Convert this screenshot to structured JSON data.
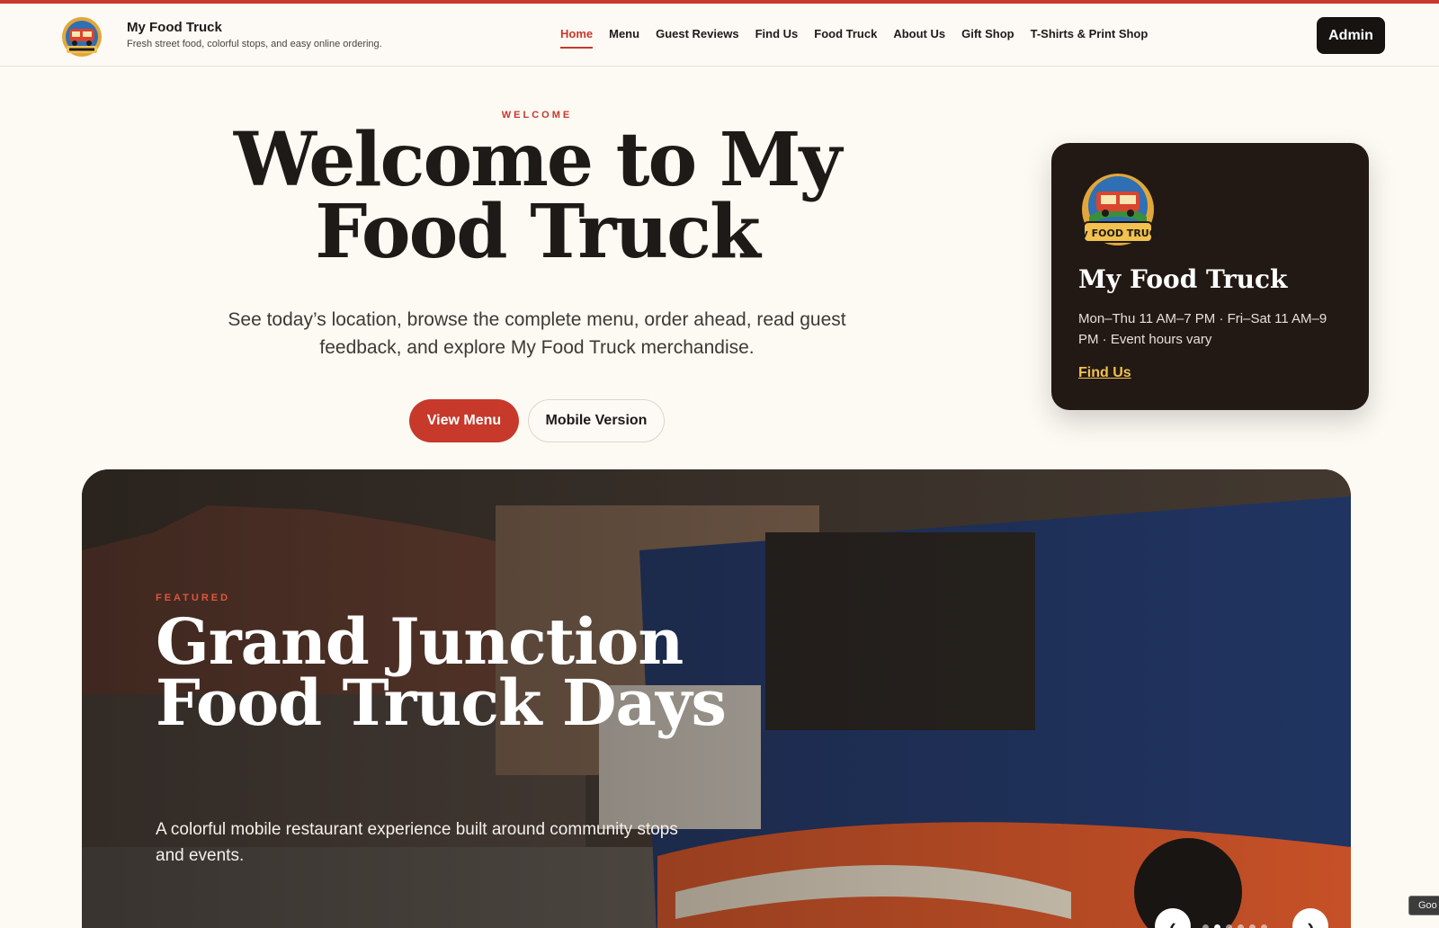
{
  "brand": {
    "name": "My Food Truck",
    "tagline": "Fresh street food, colorful stops, and easy online ordering.",
    "logo_icon": "food-truck-logo",
    "logo_text": "My FOOD TRUCK"
  },
  "nav": {
    "items": [
      {
        "label": "Home",
        "active": true
      },
      {
        "label": "Menu",
        "active": false
      },
      {
        "label": "Guest Reviews",
        "active": false
      },
      {
        "label": "Find Us",
        "active": false
      },
      {
        "label": "Food Truck",
        "active": false
      },
      {
        "label": "About Us",
        "active": false
      },
      {
        "label": "Gift Shop",
        "active": false
      },
      {
        "label": "T-Shirts & Print Shop",
        "active": false
      }
    ],
    "admin_label": "Admin"
  },
  "hero": {
    "eyebrow": "WELCOME",
    "title": "Welcome to My Food Truck",
    "subtitle": "See today’s location, browse the complete menu, order ahead, read guest feedback, and explore My Food Truck merchandise.",
    "primary_button": "View Menu",
    "secondary_button": "Mobile Version"
  },
  "info_card": {
    "title": "My Food Truck",
    "hours": "Mon–Thu 11 AM–7 PM · Fri–Sat 11 AM–9 PM · Event hours vary",
    "link": "Find Us"
  },
  "featured": {
    "eyebrow": "FEATURED",
    "title": "Grand Junction Food Truck Days",
    "subtitle": "A colorful mobile restaurant experience built around community stops and events.",
    "prev_icon": "chevron-left-icon",
    "next_icon": "chevron-right-icon",
    "prev_glyph": "‹",
    "next_glyph": "›",
    "slide_count": 6,
    "active_slide": 2
  },
  "corner_badge": "Goo",
  "colors": {
    "accent": "#c6392b",
    "background": "#fdf9f3",
    "card": "#221915",
    "link_yellow": "#f2c14e"
  }
}
